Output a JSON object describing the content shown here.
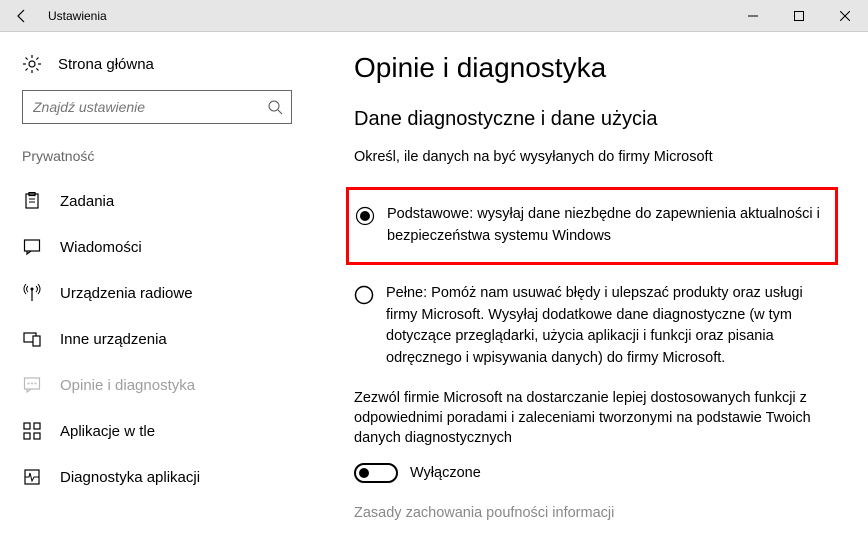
{
  "window": {
    "title": "Ustawienia"
  },
  "sidebar": {
    "home": "Strona główna",
    "search_placeholder": "Znajdź ustawienie",
    "category": "Prywatność",
    "items": [
      {
        "label": "Zadania"
      },
      {
        "label": "Wiadomości"
      },
      {
        "label": "Urządzenia radiowe"
      },
      {
        "label": "Inne urządzenia"
      },
      {
        "label": "Opinie i diagnostyka"
      },
      {
        "label": "Aplikacje w tle"
      },
      {
        "label": "Diagnostyka aplikacji"
      }
    ]
  },
  "main": {
    "title": "Opinie i diagnostyka",
    "section_title": "Dane diagnostyczne i dane użycia",
    "instruction": "Określ, ile danych na być wysyłanych do firmy Microsoft",
    "radios": [
      {
        "label": "Podstawowe: wysyłaj dane niezbędne do zapewnienia aktualności i bezpieczeństwa systemu Windows"
      },
      {
        "label": "Pełne: Pomóż nam usuwać błędy i ulepszać produkty oraz usługi firmy Microsoft. Wysyłaj dodatkowe dane diagnostyczne (w tym dotyczące przeglądarki, użycia aplikacji i funkcji oraz pisania odręcznego i wpisywania danych) do firmy Microsoft."
      }
    ],
    "permission_text": "Zezwól firmie Microsoft na dostarczanie lepiej dostosowanych funkcji z odpowiednimi poradami i zaleceniami tworzonymi na podstawie Twoich danych diagnostycznych",
    "toggle_label": "Wyłączone",
    "privacy_link": "Zasady zachowania poufności informacji"
  }
}
